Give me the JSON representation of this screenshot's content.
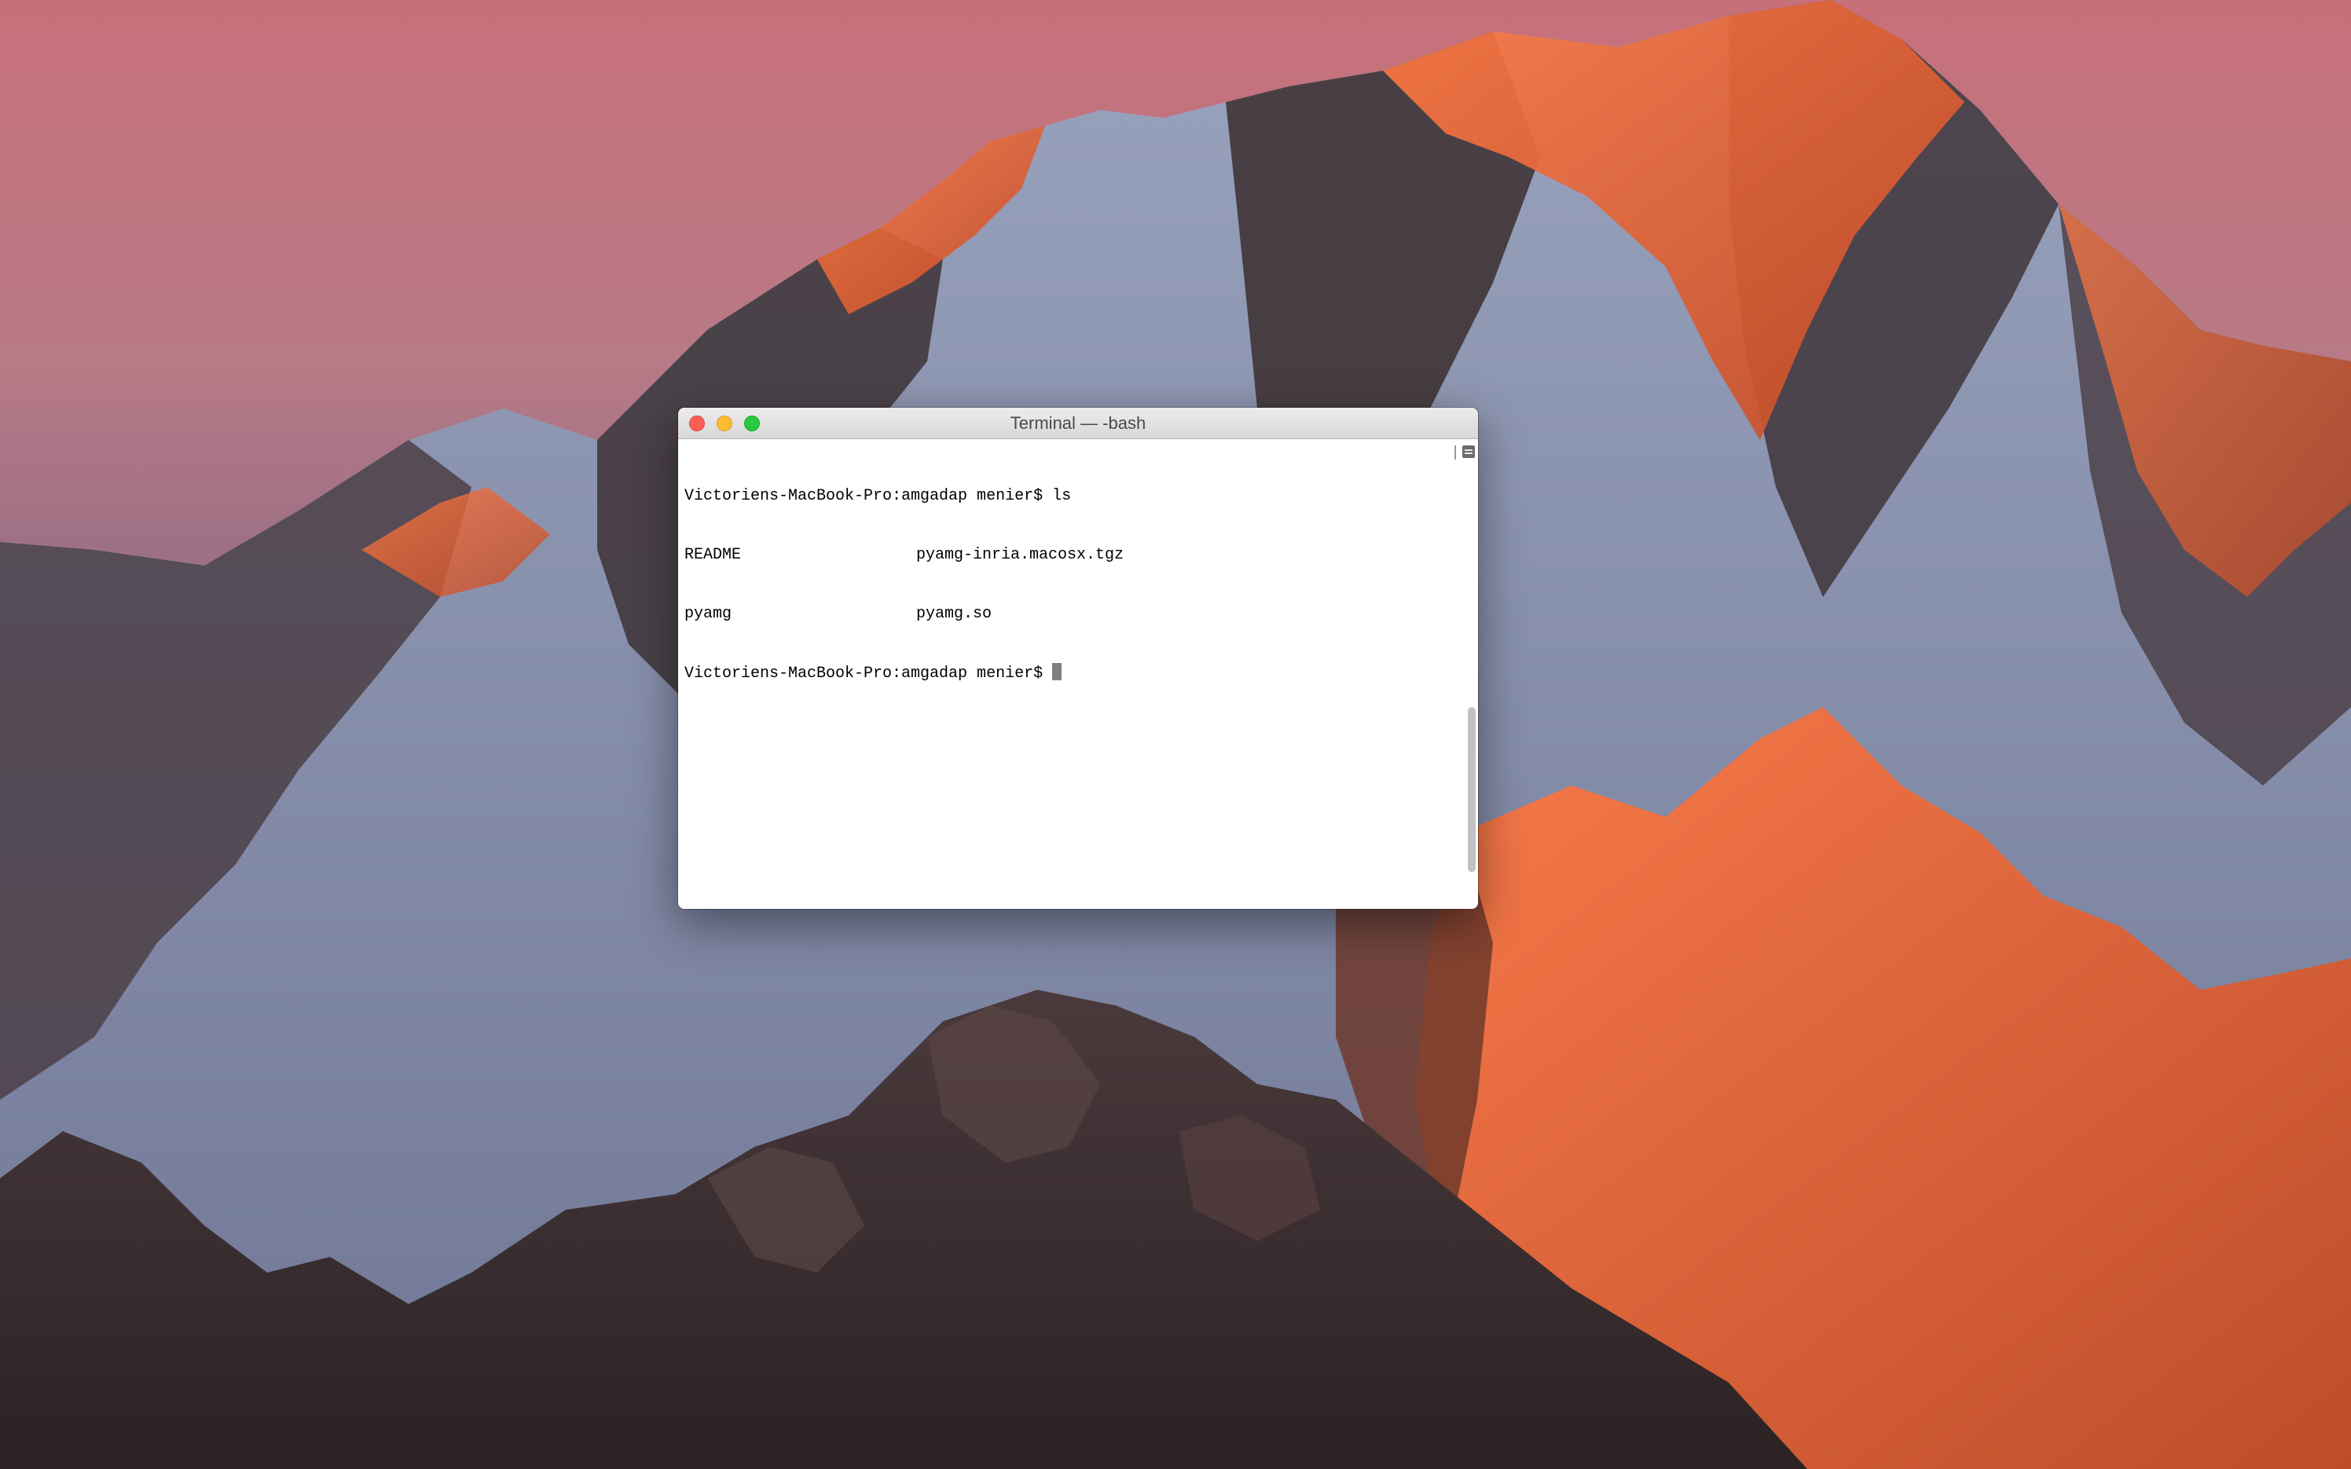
{
  "desktop": {
    "wallpaper_icon": "mountain-sunset-wallpaper"
  },
  "terminal": {
    "title": "Terminal — -bash",
    "lines": [
      {
        "text": "Victoriens-MacBook-Pro:amgadap menier$ ls"
      },
      {
        "col1": "README",
        "col2": "pyamg-inria.macosx.tgz"
      },
      {
        "col1": "pyamg",
        "col2": "pyamg.so"
      },
      {
        "text": "Victoriens-MacBook-Pro:amgadap menier$ "
      }
    ],
    "buttons": {
      "close_icon": "close-icon",
      "minimize_icon": "minimize-icon",
      "zoom_icon": "zoom-icon"
    }
  },
  "colors": {
    "close": "#fc5f57",
    "minimize": "#fdbc2e",
    "zoom": "#28c840",
    "sky_top": "#b36a73",
    "alpenglow": "#f0643a"
  }
}
